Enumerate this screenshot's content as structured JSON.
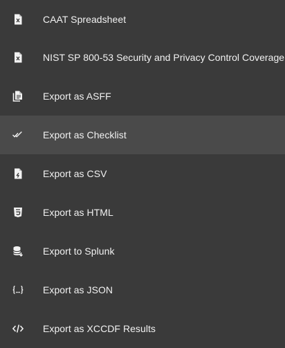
{
  "menu": {
    "items": [
      {
        "label": "CAAT Spreadsheet",
        "icon": "excel-file-icon"
      },
      {
        "label": "NIST SP 800-53 Security and Privacy Control Coverage",
        "icon": "excel-file-icon"
      },
      {
        "label": "Export as ASFF",
        "icon": "document-copy-icon"
      },
      {
        "label": "Export as Checklist",
        "icon": "double-check-icon",
        "highlighted": true
      },
      {
        "label": "Export as CSV",
        "icon": "csv-file-icon"
      },
      {
        "label": "Export as HTML",
        "icon": "html5-icon"
      },
      {
        "label": "Export to Splunk",
        "icon": "database-export-icon"
      },
      {
        "label": "Export as JSON",
        "icon": "json-braces-icon"
      },
      {
        "label": "Export as XCCDF Results",
        "icon": "code-tags-icon"
      }
    ]
  },
  "colors": {
    "background": "#3a3a3a",
    "highlight": "#4a4a4a",
    "text": "#f2f2f2"
  }
}
